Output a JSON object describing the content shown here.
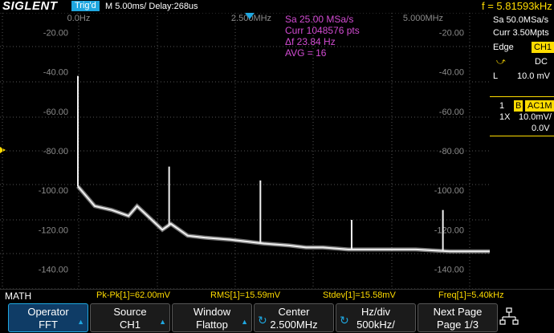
{
  "header": {
    "brand": "SIGLENT",
    "trigger_status": "Trig'd",
    "timebase": "M 5.00ms/ Delay:268us",
    "frequency": "f = 5.81593kHz"
  },
  "fft": {
    "x_ticks": [
      "0.0Hz",
      "2.500MHz",
      "5.000MHz"
    ],
    "y_ticks_left": [
      "-20.00",
      "-40.00",
      "-60.00",
      "-80.00",
      "-100.00",
      "-120.00",
      "-140.00"
    ],
    "y_ticks_right": [
      "-20.00",
      "-40.00",
      "-60.00",
      "-80.00",
      "-100.00",
      "-120.00",
      "-140.00"
    ],
    "info": [
      "Sa 25.00 MSa/s",
      "Curr 1048576 pts",
      "Δf 23.84 Hz",
      "AVG = 16"
    ],
    "ref_marker": "1"
  },
  "right_panel": {
    "sample_rate": "Sa 50.0MSa/s",
    "curr_pts": "Curr 3.50Mpts",
    "trigger_type": "Edge",
    "trigger_source": "CH1",
    "coupling": "DC",
    "level_label": "L",
    "level_value": "10.0 mV",
    "ch_num": "1",
    "ch_bw": "B",
    "ch_coupling": "AC1M",
    "probe": "1X",
    "volts_div": "10.0mV/",
    "offset": "0.0V"
  },
  "measurements": {
    "label": "MATH",
    "items": [
      "Pk-Pk[1]=62.00mV",
      "RMS[1]=15.59mV",
      "Stdev[1]=15.58mV",
      "Freq[1]=5.40kHz"
    ]
  },
  "softkeys": [
    {
      "line1": "Operator",
      "line2": "FFT"
    },
    {
      "line1": "Source",
      "line2": "CH1"
    },
    {
      "line1": "Window",
      "line2": "Flattop"
    },
    {
      "line1": "Center",
      "line2": "2.500MHz"
    },
    {
      "line1": "Hz/div",
      "line2": "500kHz/"
    },
    {
      "line1": "Next Page",
      "line2": "Page 1/3"
    }
  ],
  "colors": {
    "accent": "#1fa7e0",
    "info_text": "#d24bd2",
    "yellow": "#ffdc00",
    "trace": "#e8e8e8"
  },
  "chart_data": {
    "type": "line",
    "title": "",
    "xlabel": "",
    "ylabel": "",
    "xlim": [
      0,
      5000000
    ],
    "ylim": [
      -150,
      -10
    ],
    "series": [
      {
        "x": [
          0,
          100000,
          200000,
          400000,
          600000,
          700000,
          800000,
          1000000,
          1100000,
          1300000,
          1500000,
          1800000,
          2000000,
          2200000,
          2500000,
          2700000,
          2900000,
          3200000,
          3500000,
          4000000,
          4400000,
          4700000,
          5000000
        ],
        "y": [
          -98,
          -103,
          -108,
          -110,
          -113,
          -108,
          -112,
          -120,
          -117,
          -123,
          -124,
          -125,
          -126,
          -127,
          -128,
          -129,
          -129,
          -130,
          -130,
          -130,
          -131,
          -131,
          -131
        ]
      }
    ],
    "peaks": [
      {
        "x": 0,
        "y": -42
      },
      {
        "x": 1080000,
        "y": -88
      },
      {
        "x": 2160000,
        "y": -95
      },
      {
        "x": 3240000,
        "y": -115
      },
      {
        "x": 4320000,
        "y": -110
      }
    ]
  }
}
